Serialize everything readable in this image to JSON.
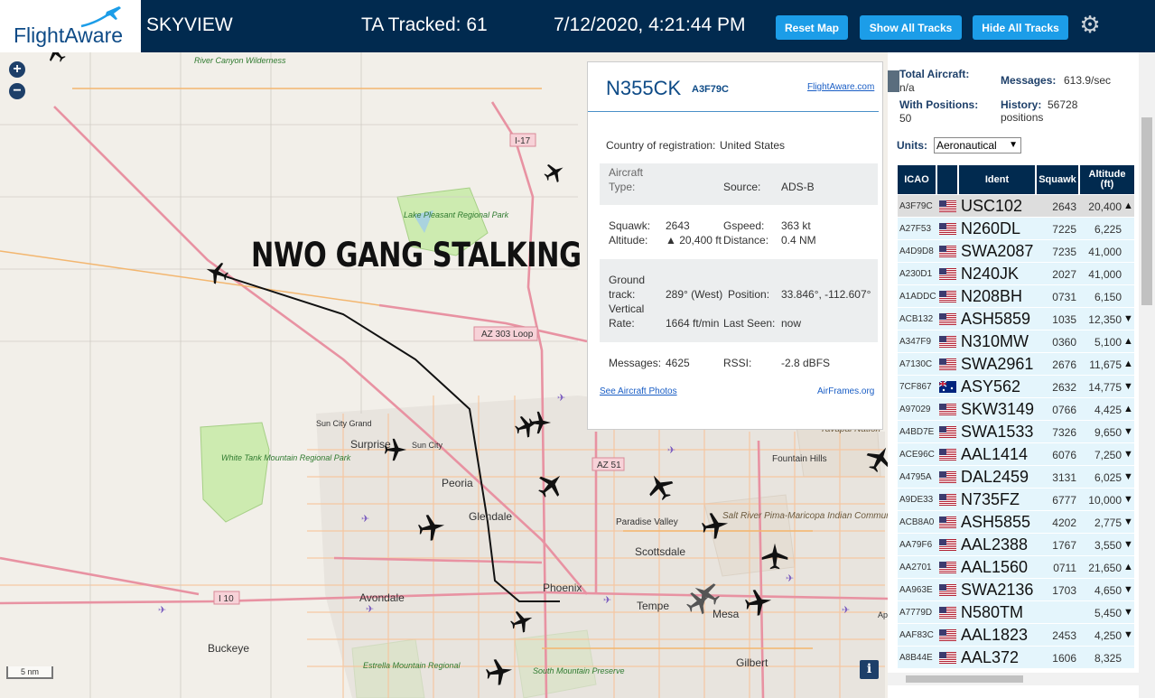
{
  "header": {
    "logo_text": "FlightAware",
    "title": "SKYVIEW",
    "tracked": "TA Tracked: 61",
    "datetime": "7/12/2020, 4:21:44 PM",
    "buttons": {
      "reset": "Reset Map",
      "show": "Show All Tracks",
      "hide": "Hide All Tracks"
    },
    "settings_icon": "gear-icon"
  },
  "map": {
    "zoom_in": "+",
    "zoom_out": "−",
    "overlay_text": "NWO GANG STALKING",
    "scale": "5 nm",
    "info_button": "i",
    "labels": {
      "river_canyon": "River Canyon Wilderness",
      "lake_pleasant": "Lake Pleasant Regional Park",
      "i17": "I-17",
      "az303": "AZ 303 Loop",
      "sun_city_grand": "Sun City Grand",
      "surprise": "Surprise",
      "sun_city": "Sun City",
      "peoria": "Peoria",
      "glendale": "Glendale",
      "white_tank": "White Tank Mountain Regional Park",
      "az51": "AZ 51",
      "paradise_valley": "Paradise Valley",
      "scottsdale": "Scottsdale",
      "yavapai": "Yavapai Nation",
      "fountain_hills": "Fountain Hills",
      "salt_river": "Salt River Pima-Maricopa Indian Community",
      "phoenix": "Phoenix",
      "tempe": "Tempe",
      "mesa": "Mesa",
      "avondale": "Avondale",
      "i10": "I 10",
      "buckeye": "Buckeye",
      "estrella": "Estrella Mountain Regional",
      "south_mountain": "South Mountain Preserve",
      "gilbert": "Gilbert",
      "apache": "Ap"
    }
  },
  "popup": {
    "registration": "N355CK",
    "icao": "A3F79C",
    "fa_link": "FlightAware.com",
    "country_label": "Country of registration:",
    "country": "United States",
    "aircraft_type_label1": "Aircraft",
    "aircraft_type_label2": "Type:",
    "source_label": "Source:",
    "source": "ADS-B",
    "squawk_label": "Squawk:",
    "squawk": "2643",
    "gspeed_label": "Gspeed:",
    "gspeed": "363 kt",
    "altitude_label": "Altitude:",
    "altitude": "▲ 20,400 ft",
    "distance_label": "Distance:",
    "distance": "0.4 NM",
    "ground_label1": "Ground",
    "ground_label2": "track:",
    "track": "289° (West)",
    "position_label": "Position:",
    "position": "33.846°, -112.607°",
    "vertical_label1": "Vertical",
    "vertical_label2": "Rate:",
    "vrate": "1664 ft/min",
    "last_seen_label": "Last Seen:",
    "last_seen": "now",
    "messages_label": "Messages:",
    "messages": "4625",
    "rssi_label": "RSSI:",
    "rssi": "-2.8 dBFS",
    "photos_link": "See Aircraft Photos",
    "airframes_link": "AirFrames.org"
  },
  "sidebar": {
    "total_label": "Total Aircraft:",
    "total": "n/a",
    "messages_label": "Messages:",
    "messages": "613.9/sec",
    "positions_label": "With Positions:",
    "positions": "50",
    "history_label": "History:",
    "history": "56728 positions",
    "units_label": "Units:",
    "units_value": "Aeronautical",
    "columns": {
      "icao": "ICAO",
      "ident": "Ident",
      "squawk": "Squawk",
      "altitude": "Altitude (ft)"
    },
    "rows": [
      {
        "icao": "A3F79C",
        "flag": "us",
        "ident": "USC102",
        "squawk": "2643",
        "alt": "20,400",
        "arrow": "▲",
        "selected": true
      },
      {
        "icao": "A27F53",
        "flag": "us",
        "ident": "N260DL",
        "squawk": "7225",
        "alt": "6,225",
        "arrow": ""
      },
      {
        "icao": "A4D9D8",
        "flag": "us",
        "ident": "SWA2087",
        "squawk": "7235",
        "alt": "41,000",
        "arrow": ""
      },
      {
        "icao": "A230D1",
        "flag": "us",
        "ident": "N240JK",
        "squawk": "2027",
        "alt": "41,000",
        "arrow": ""
      },
      {
        "icao": "A1ADDC",
        "flag": "us",
        "ident": "N208BH",
        "squawk": "0731",
        "alt": "6,150",
        "arrow": ""
      },
      {
        "icao": "ACB132",
        "flag": "us",
        "ident": "ASH5859",
        "squawk": "1035",
        "alt": "12,350",
        "arrow": "▼"
      },
      {
        "icao": "A347F9",
        "flag": "us",
        "ident": "N310MW",
        "squawk": "0360",
        "alt": "5,100",
        "arrow": "▲"
      },
      {
        "icao": "A7130C",
        "flag": "us",
        "ident": "SWA2961",
        "squawk": "2676",
        "alt": "11,675",
        "arrow": "▲"
      },
      {
        "icao": "7CF867",
        "flag": "au",
        "ident": "ASY562",
        "squawk": "2632",
        "alt": "14,775",
        "arrow": "▼"
      },
      {
        "icao": "A97029",
        "flag": "us",
        "ident": "SKW3149",
        "squawk": "0766",
        "alt": "4,425",
        "arrow": "▲"
      },
      {
        "icao": "A4BD7E",
        "flag": "us",
        "ident": "SWA1533",
        "squawk": "7326",
        "alt": "9,650",
        "arrow": "▼"
      },
      {
        "icao": "ACE96C",
        "flag": "us",
        "ident": "AAL1414",
        "squawk": "6076",
        "alt": "7,250",
        "arrow": "▼"
      },
      {
        "icao": "A4795A",
        "flag": "us",
        "ident": "DAL2459",
        "squawk": "3131",
        "alt": "6,025",
        "arrow": "▼"
      },
      {
        "icao": "A9DE33",
        "flag": "us",
        "ident": "N735FZ",
        "squawk": "6777",
        "alt": "10,000",
        "arrow": "▼"
      },
      {
        "icao": "ACB8A0",
        "flag": "us",
        "ident": "ASH5855",
        "squawk": "4202",
        "alt": "2,775",
        "arrow": "▼"
      },
      {
        "icao": "AA79F6",
        "flag": "us",
        "ident": "AAL2388",
        "squawk": "1767",
        "alt": "3,550",
        "arrow": "▼"
      },
      {
        "icao": "AA2701",
        "flag": "us",
        "ident": "AAL1560",
        "squawk": "0711",
        "alt": "21,650",
        "arrow": "▲"
      },
      {
        "icao": "AA963E",
        "flag": "us",
        "ident": "SWA2136",
        "squawk": "1703",
        "alt": "4,650",
        "arrow": "▼"
      },
      {
        "icao": "A7779D",
        "flag": "us",
        "ident": "N580TM",
        "squawk": "",
        "alt": "5,450",
        "arrow": "▼"
      },
      {
        "icao": "AAF83C",
        "flag": "us",
        "ident": "AAL1823",
        "squawk": "2453",
        "alt": "4,250",
        "arrow": "▼"
      },
      {
        "icao": "A8B44E",
        "flag": "us",
        "ident": "AAL372",
        "squawk": "1606",
        "alt": "8,325",
        "arrow": ""
      }
    ]
  },
  "colors": {
    "header_bg": "#012a4f",
    "button": "#1c9de8",
    "row_bg": "#e4f5fc",
    "brand": "#0d4a86"
  }
}
